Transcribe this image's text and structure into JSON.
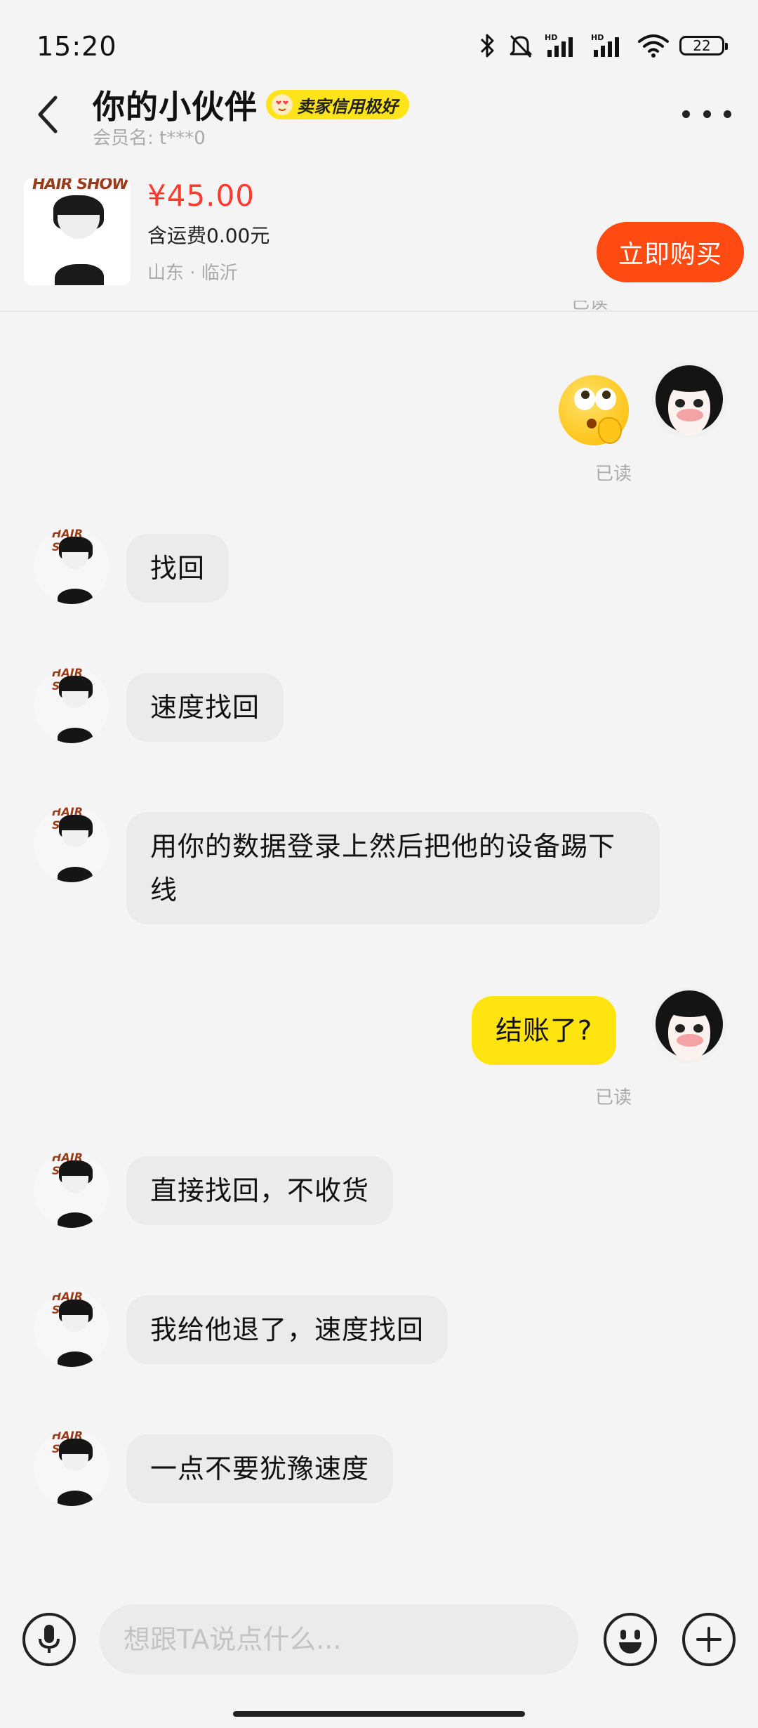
{
  "status_bar": {
    "time": "15:20",
    "battery": "22",
    "icons": [
      "bluetooth-icon",
      "mute-icon",
      "signal-hd-icon",
      "signal-hd-icon",
      "wifi-icon",
      "battery-icon"
    ]
  },
  "header": {
    "title": "你的小伙伴",
    "badge": "卖家信用极好",
    "member_name": "会员名: t***0"
  },
  "product": {
    "thumb_text": "HAIR SHOW",
    "price": "¥45.00",
    "shipping": "含运费0.00元",
    "location": "山东 · 临沂",
    "buy_label": "立即购买"
  },
  "messages": {
    "read_label": "已读",
    "m1": "找回",
    "m2": "速度找回",
    "m3": "用你的数据登录上然后把他的设备踢下线",
    "m4": "结账了?",
    "m5": "直接找回，不收货",
    "m6": "我给他退了，速度找回",
    "m7": "一点不要犹豫速度"
  },
  "input": {
    "placeholder": "想跟TA说点什么..."
  },
  "colors": {
    "accent_yellow": "#ffe40f",
    "buy_orange": "#ff4a11",
    "price_red": "#ff3b2f",
    "background": "#f4f4f4"
  }
}
